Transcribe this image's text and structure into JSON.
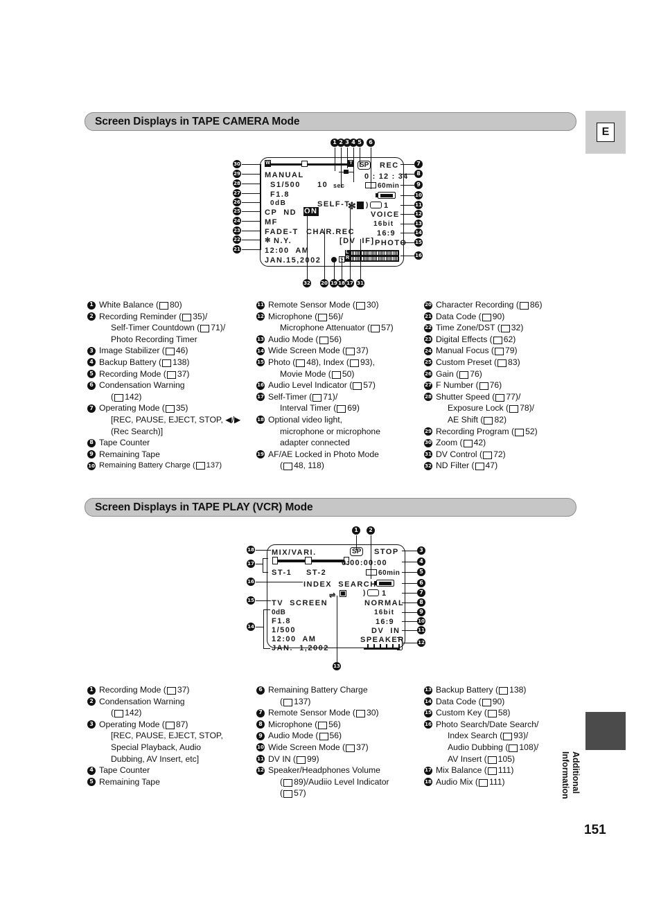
{
  "page": {
    "number": "151",
    "edge_label_line1": "Additional",
    "edge_label_line2": "Information",
    "lang_badge": "E"
  },
  "sections": [
    {
      "id": "camera",
      "title": "Screen Displays in TAPE CAMERA Mode"
    },
    {
      "id": "vcr",
      "title": "Screen Displays in TAPE PLAY (VCR) Mode"
    }
  ],
  "camera_display": {
    "left_text": {
      "manual": "MANUAL",
      "shutter": "S1/500",
      "fnumber": "F1.8",
      "gain": "0dB",
      "custom_nd": "CP  ND",
      "nd_on": "ON",
      "focus": "MF",
      "fade": "FADE-T",
      "timezone": "N.Y.",
      "time": "12:00  AM",
      "date": "JAN.15,2002"
    },
    "center_text": {
      "selftimer_count": "10",
      "selftimer_sec": "sec",
      "selftimer": "SELF-T",
      "char_rec": "CHAR.REC",
      "dv_if": "[DV  IF]"
    },
    "right_text": {
      "rec_mode": "SP",
      "operating": "REC",
      "counter": "0 : 12 : 34",
      "remaining_tape": "60min",
      "remote": "1",
      "mic": "VOICE",
      "audio_mode": "16bit",
      "wide": "16:9",
      "photo": "PHOTO",
      "audio_level_l": "L",
      "audio_level_r": "R"
    },
    "callouts_top": [
      "1",
      "2",
      "3",
      "4",
      "5",
      "6"
    ],
    "callouts_right": [
      "7",
      "8",
      "9",
      "10",
      "11",
      "12",
      "13",
      "14",
      "15",
      "16"
    ],
    "callouts_left": [
      "30",
      "29",
      "28",
      "27",
      "26",
      "25",
      "24",
      "23",
      "22",
      "21"
    ],
    "callouts_bottom": [
      "32",
      "20",
      "19",
      "18",
      "17",
      "31"
    ]
  },
  "vcr_display": {
    "left_text": {
      "mix": "MIX/VARI.",
      "st1": "ST-1",
      "st2": "ST-2",
      "tv_screen": "TV  SCREEN",
      "gain": "0dB",
      "fnumber": "F1.8",
      "shutter": "1/500",
      "time": "12:00  AM",
      "date": "JAN.  1,2002"
    },
    "center_text": {
      "index_search": "INDEX  SEARCH"
    },
    "right_text": {
      "rec_mode": "SP",
      "operating": "STOP",
      "counter": "0:00:00:00",
      "remaining_tape": "60min",
      "remote": "1",
      "mic": "NORMAL",
      "audio_mode": "16bit",
      "wide": "16:9",
      "dv_in": "DV  IN",
      "speaker": "SPEAKER"
    },
    "callouts_top": [
      "1",
      "2"
    ],
    "callouts_right": [
      "3",
      "4",
      "5",
      "6",
      "7",
      "8",
      "9",
      "10",
      "11",
      "12"
    ],
    "callouts_left": [
      "18",
      "17",
      "16",
      "15",
      "14"
    ],
    "callouts_bottom": [
      "13"
    ]
  },
  "camera_legend": {
    "col1": [
      {
        "n": "1",
        "lines": [
          {
            "t": "White Balance (",
            "book": true,
            "p": "80)"
          }
        ]
      },
      {
        "n": "2",
        "lines": [
          {
            "t": "Recording Reminder (",
            "book": true,
            "p": "35)/"
          },
          {
            "t": "Self-Timer Countdown (",
            "book": true,
            "p": "71)/",
            "indent": true
          },
          {
            "t": "Photo Recording Timer",
            "indent": true
          }
        ]
      },
      {
        "n": "3",
        "lines": [
          {
            "t": "Image Stabilizer (",
            "book": true,
            "p": "46)"
          }
        ]
      },
      {
        "n": "4",
        "lines": [
          {
            "t": "Backup Battery (",
            "book": true,
            "p": "138)"
          }
        ]
      },
      {
        "n": "5",
        "lines": [
          {
            "t": "Recording Mode (",
            "book": true,
            "p": "37)"
          }
        ]
      },
      {
        "n": "6",
        "lines": [
          {
            "t": "Condensation Warning"
          },
          {
            "t": "(",
            "book": true,
            "p": "142)",
            "indent": true
          }
        ]
      },
      {
        "n": "7",
        "lines": [
          {
            "t": "Operating Mode (",
            "book": true,
            "p": "35)"
          },
          {
            "t": "[REC, PAUSE, EJECT, STOP, ◀/▶",
            "indent": true
          },
          {
            "t": "(Rec Search)]",
            "indent": true
          }
        ]
      },
      {
        "n": "8",
        "lines": [
          {
            "t": "Tape Counter"
          }
        ]
      },
      {
        "n": "9",
        "lines": [
          {
            "t": "Remaining Tape"
          }
        ]
      },
      {
        "n": "10",
        "lines": [
          {
            "t": "Remaining Battery Charge (",
            "book": true,
            "p": "137)",
            "small": true
          }
        ]
      }
    ],
    "col2": [
      {
        "n": "11",
        "lines": [
          {
            "t": "Remote Sensor Mode (",
            "book": true,
            "p": "30)"
          }
        ]
      },
      {
        "n": "12",
        "lines": [
          {
            "t": "Microphone (",
            "book": true,
            "p": "56)/"
          },
          {
            "t": "Microphone Attenuator (",
            "book": true,
            "p": "57)",
            "indent": true
          }
        ]
      },
      {
        "n": "13",
        "lines": [
          {
            "t": "Audio Mode (",
            "book": true,
            "p": "56)"
          }
        ]
      },
      {
        "n": "14",
        "lines": [
          {
            "t": "Wide Screen Mode (",
            "book": true,
            "p": "37)"
          }
        ]
      },
      {
        "n": "15",
        "lines": [
          {
            "t": "Photo (",
            "book": true,
            "p": "48), Index (",
            "book2": true,
            "p2": "93),"
          },
          {
            "t": "Movie Mode (",
            "book": true,
            "p": "50)",
            "indent": true
          }
        ]
      },
      {
        "n": "16",
        "lines": [
          {
            "t": "Audio Level Indicator (",
            "book": true,
            "p": "57)"
          }
        ]
      },
      {
        "n": "17",
        "lines": [
          {
            "t": "Self-Timer (",
            "book": true,
            "p": "71)/"
          },
          {
            "t": "Interval Timer (",
            "book": true,
            "p": "69)",
            "indent": true
          }
        ]
      },
      {
        "n": "18",
        "lines": [
          {
            "t": "Optional video light,"
          },
          {
            "t": "microphone or microphone",
            "indent": true
          },
          {
            "t": "adapter connected",
            "indent": true
          }
        ]
      },
      {
        "n": "19",
        "lines": [
          {
            "t": "AF/AE Locked in Photo Mode"
          },
          {
            "t": "(",
            "book": true,
            "p": "48, 118)",
            "indent": true
          }
        ]
      }
    ],
    "col3": [
      {
        "n": "20",
        "lines": [
          {
            "t": "Character Recording (",
            "book": true,
            "p": "86)"
          }
        ]
      },
      {
        "n": "21",
        "lines": [
          {
            "t": "Data Code (",
            "book": true,
            "p": "90)"
          }
        ]
      },
      {
        "n": "22",
        "lines": [
          {
            "t": "Time Zone/DST (",
            "book": true,
            "p": "32)"
          }
        ]
      },
      {
        "n": "23",
        "lines": [
          {
            "t": "Digital Effects (",
            "book": true,
            "p": "62)"
          }
        ]
      },
      {
        "n": "24",
        "lines": [
          {
            "t": "Manual Focus (",
            "book": true,
            "p": "79)"
          }
        ]
      },
      {
        "n": "25",
        "lines": [
          {
            "t": "Custom Preset (",
            "book": true,
            "p": "83)"
          }
        ]
      },
      {
        "n": "26",
        "lines": [
          {
            "t": "Gain (",
            "book": true,
            "p": "76)"
          }
        ]
      },
      {
        "n": "27",
        "lines": [
          {
            "t": "F Number (",
            "book": true,
            "p": "76)"
          }
        ]
      },
      {
        "n": "28",
        "lines": [
          {
            "t": "Shutter Speed (",
            "book": true,
            "p": "77)/"
          },
          {
            "t": "Exposure Lock (",
            "book": true,
            "p": "78)/",
            "indent": true
          },
          {
            "t": "AE Shift (",
            "book": true,
            "p": "82)",
            "indent": true
          }
        ]
      },
      {
        "n": "29",
        "lines": [
          {
            "t": "Recording Program (",
            "book": true,
            "p": "52)"
          }
        ]
      },
      {
        "n": "30",
        "lines": [
          {
            "t": "Zoom (",
            "book": true,
            "p": "42)"
          }
        ]
      },
      {
        "n": "31",
        "lines": [
          {
            "t": "DV Control (",
            "book": true,
            "p": "72)"
          }
        ]
      },
      {
        "n": "32",
        "lines": [
          {
            "t": "ND Filter (",
            "book": true,
            "p": "47)"
          }
        ]
      }
    ]
  },
  "vcr_legend": {
    "col1": [
      {
        "n": "1",
        "lines": [
          {
            "t": "Recording Mode (",
            "book": true,
            "p": "37)"
          }
        ]
      },
      {
        "n": "2",
        "lines": [
          {
            "t": "Condensation Warning"
          },
          {
            "t": "(",
            "book": true,
            "p": "142)",
            "indent": true
          }
        ]
      },
      {
        "n": "3",
        "lines": [
          {
            "t": "Operating Mode (",
            "book": true,
            "p": "87)"
          },
          {
            "t": "[REC, PAUSE, EJECT, STOP,",
            "indent": true
          },
          {
            "t": "Special Playback, Audio",
            "indent": true
          },
          {
            "t": "Dubbing, AV Insert, etc]",
            "indent": true
          }
        ]
      },
      {
        "n": "4",
        "lines": [
          {
            "t": "Tape Counter"
          }
        ]
      },
      {
        "n": "5",
        "lines": [
          {
            "t": "Remaining Tape"
          }
        ]
      }
    ],
    "col2": [
      {
        "n": "6",
        "lines": [
          {
            "t": "Remaining Battery Charge"
          },
          {
            "t": "(",
            "book": true,
            "p": "137)",
            "indent": true
          }
        ]
      },
      {
        "n": "7",
        "lines": [
          {
            "t": "Remote Sensor Mode (",
            "book": true,
            "p": "30)"
          }
        ]
      },
      {
        "n": "8",
        "lines": [
          {
            "t": "Microphone (",
            "book": true,
            "p": "56)"
          }
        ]
      },
      {
        "n": "9",
        "lines": [
          {
            "t": "Audio Mode (",
            "book": true,
            "p": "56)"
          }
        ]
      },
      {
        "n": "10",
        "lines": [
          {
            "t": "Wide Screen Mode (",
            "book": true,
            "p": "37)"
          }
        ]
      },
      {
        "n": "11",
        "lines": [
          {
            "t": "DV IN (",
            "book": true,
            "p": "99)"
          }
        ]
      },
      {
        "n": "12",
        "lines": [
          {
            "t": "Speaker/Headphones Volume"
          },
          {
            "t": "(",
            "book": true,
            "p": "89)/Audiio Level Indicator",
            "indent": true
          },
          {
            "t": "(",
            "book": true,
            "p": "57)",
            "indent": true
          }
        ]
      }
    ],
    "col3": [
      {
        "n": "13",
        "lines": [
          {
            "t": "Backup Battery (",
            "book": true,
            "p": "138)"
          }
        ]
      },
      {
        "n": "14",
        "lines": [
          {
            "t": "Data Code (",
            "book": true,
            "p": "90)"
          }
        ]
      },
      {
        "n": "15",
        "lines": [
          {
            "t": "Custom Key (",
            "book": true,
            "p": "58)"
          }
        ]
      },
      {
        "n": "16",
        "lines": [
          {
            "t": "Photo Search/Date Search/"
          },
          {
            "t": "Index Search (",
            "book": true,
            "p": "93)/",
            "indent": true
          },
          {
            "t": "Audio Dubbing (",
            "book": true,
            "p": "108)/",
            "indent": true
          },
          {
            "t": "AV Insert (",
            "book": true,
            "p": "105)",
            "indent": true
          }
        ]
      },
      {
        "n": "17",
        "lines": [
          {
            "t": "Mix Balance (",
            "book": true,
            "p": "111)"
          }
        ]
      },
      {
        "n": "18",
        "lines": [
          {
            "t": "Audio Mix (",
            "book": true,
            "p": "111)"
          }
        ]
      }
    ]
  }
}
